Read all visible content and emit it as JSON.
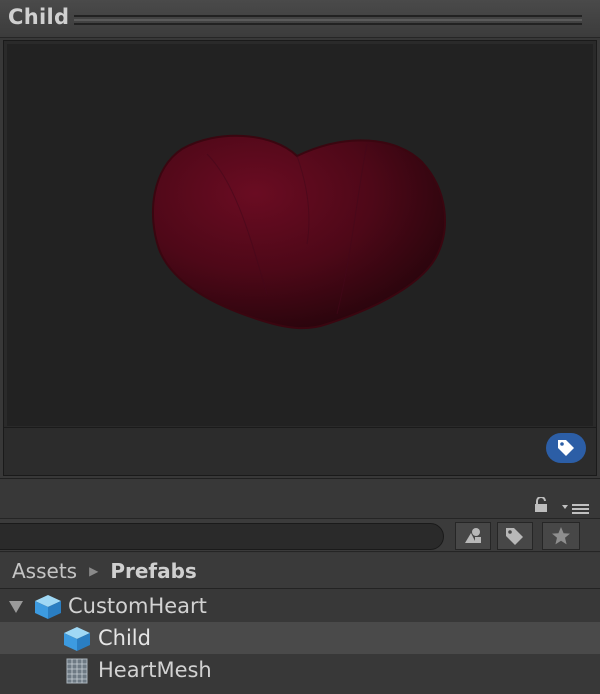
{
  "window": {
    "title": "Child"
  },
  "preview": {
    "subject_icon": "heart-mesh-preview",
    "badge_icon": "label-tag-icon"
  },
  "toolbar": {
    "lock_icon": "lock-icon",
    "menu_icon": "context-menu-icon"
  },
  "search": {
    "value": "",
    "placeholder": ""
  },
  "filter_buttons": [
    "search-by-type-icon",
    "search-by-label-icon",
    "favorites-star-icon"
  ],
  "breadcrumb": {
    "items": [
      "Assets",
      "Prefabs"
    ]
  },
  "tree": {
    "items": [
      {
        "label": "CustomHeart",
        "icon": "prefab-cube-icon",
        "expanded": true
      },
      {
        "label": "Child",
        "icon": "prefab-cube-icon",
        "selected": true
      },
      {
        "label": "HeartMesh",
        "icon": "mesh-grid-icon"
      }
    ]
  },
  "colors": {
    "heart": "#5a0a1a",
    "selection": "#4a4a4a",
    "label_badge": "#2c5ea6"
  }
}
